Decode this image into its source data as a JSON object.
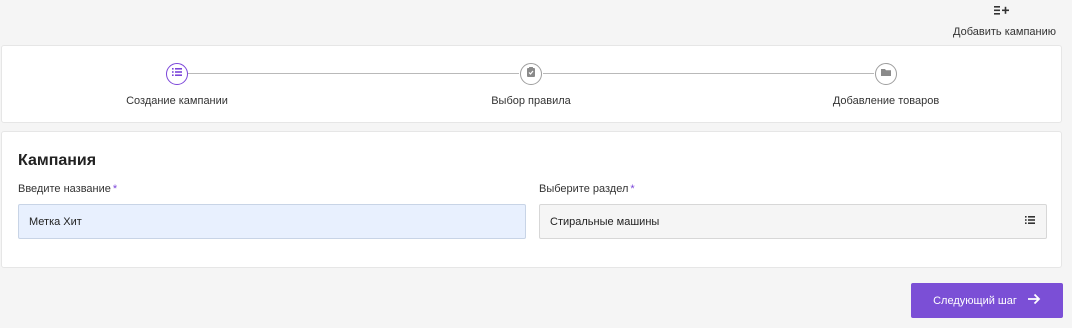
{
  "header": {
    "add_campaign_label": "Добавить кампанию",
    "add_campaign_icon": "list-add-icon"
  },
  "stepper": {
    "steps": [
      {
        "label": "Создание кампании",
        "icon": "list-icon",
        "active": true
      },
      {
        "label": "Выбор правила",
        "icon": "clipboard-icon",
        "active": false
      },
      {
        "label": "Добавление товаров",
        "icon": "folder-icon",
        "active": false
      }
    ]
  },
  "form": {
    "title": "Кампания",
    "name_label": "Введите название",
    "name_value": "Метка Хит",
    "section_label": "Выберите раздел",
    "section_value": "Стиральные машины",
    "required_mark": "*",
    "section_icon": "list-icon"
  },
  "footer": {
    "next_button_label": "Следующий шаг",
    "next_icon": "arrow-right-icon"
  },
  "colors": {
    "accent": "#7b4fd6",
    "input_filled_bg": "#e8f0fe",
    "page_bg": "#f5f5f5"
  }
}
